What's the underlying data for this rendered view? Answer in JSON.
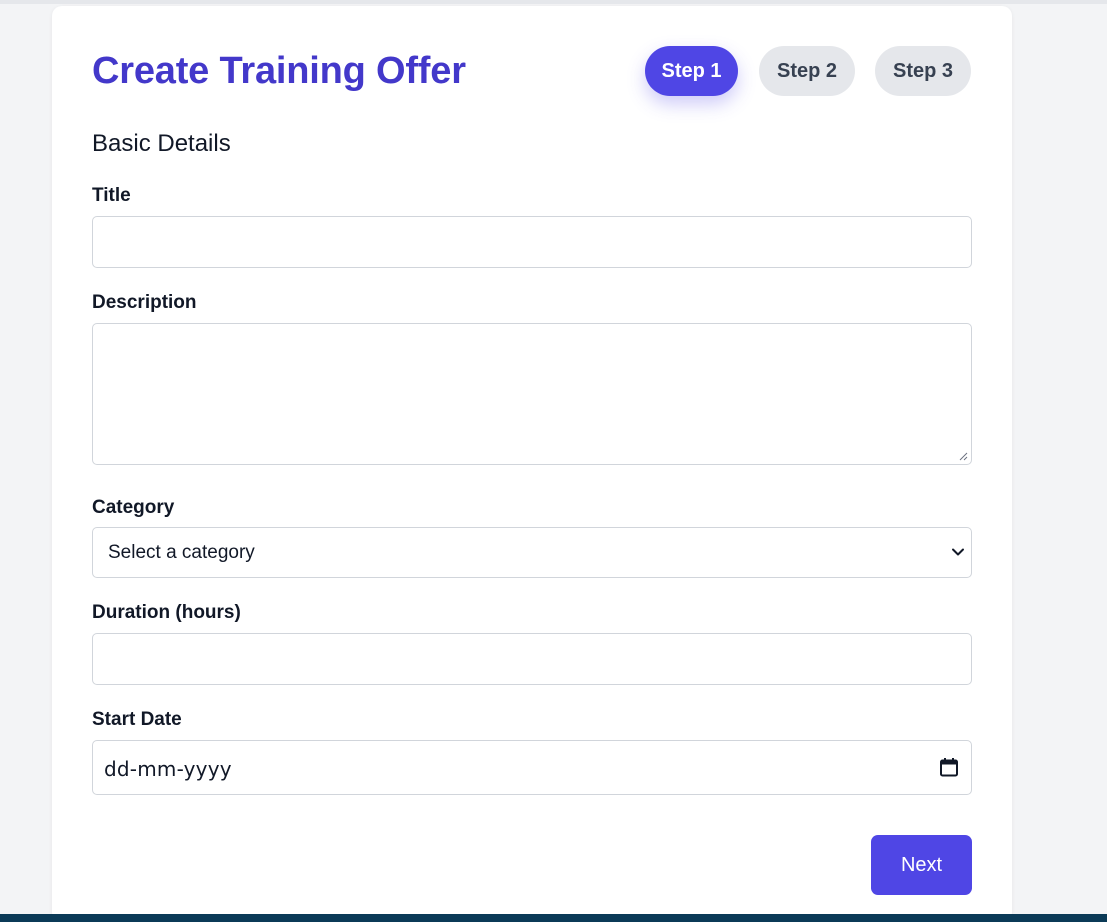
{
  "form": {
    "title": "Create Training Offer",
    "steps": [
      {
        "label": "Step 1",
        "active": true
      },
      {
        "label": "Step 2",
        "active": false
      },
      {
        "label": "Step 3",
        "active": false
      }
    ],
    "section_title": "Basic Details",
    "fields": {
      "title": {
        "label": "Title",
        "value": ""
      },
      "description": {
        "label": "Description",
        "value": ""
      },
      "category": {
        "label": "Category",
        "selected": "Select a category"
      },
      "duration": {
        "label": "Duration (hours)",
        "value": ""
      },
      "start_date": {
        "label": "Start Date",
        "placeholder": "dd-mm-yyyy"
      }
    },
    "next_label": "Next"
  },
  "colors": {
    "accent": "#4f46e5",
    "title": "#4338ca",
    "inactive_step": "#e5e7eb",
    "page_background": "#f3f4f6"
  },
  "icons": [
    "chevron-down-icon",
    "calendar-icon",
    "resize-grip-icon"
  ]
}
